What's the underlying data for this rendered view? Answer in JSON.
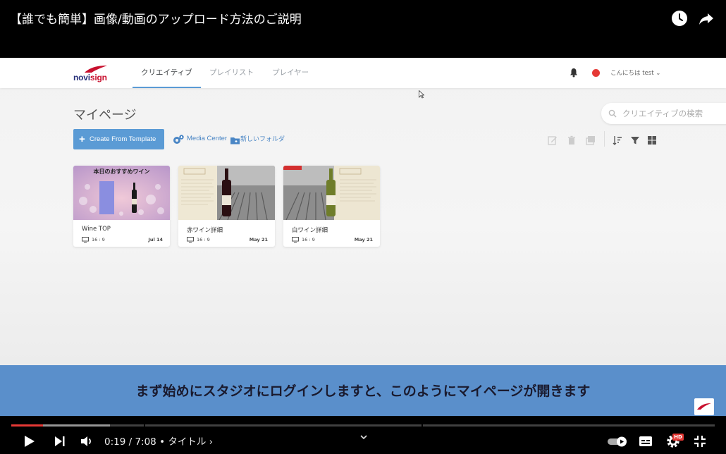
{
  "video": {
    "title": "【誰でも簡単】画像/動画のアップロード方法のご説明",
    "caption": "まず始めにスタジオにログインしますと、このようにマイページが開きます"
  },
  "app": {
    "logo": {
      "part1": "novi",
      "part2": "sign"
    },
    "tabs": [
      {
        "label": "クリエイティブ",
        "active": true
      },
      {
        "label": "プレイリスト",
        "active": false
      },
      {
        "label": "プレイヤー",
        "active": false
      }
    ],
    "greeting": "こんにちは test",
    "page_title": "マイページ",
    "search_placeholder": "クリエイティブの検索",
    "create_button": "Create From Template",
    "media_center": "Media Center",
    "new_folder": "新しいフォルダ",
    "cards": [
      {
        "name": "Wine TOP",
        "ratio": "16 : 9",
        "date": "Jul 14",
        "thumb_title": "本日のおすすめワイン"
      },
      {
        "name": "赤ワイン詳細",
        "ratio": "16 : 9",
        "date": "May 21"
      },
      {
        "name": "白ワイン詳細",
        "ratio": "16 : 9",
        "date": "May 21"
      }
    ]
  },
  "player": {
    "time": "0:19 / 7:08",
    "chapter": "• タイトル ›",
    "progress_fraction": 0.045,
    "buffer_fraction": 0.14,
    "hd_badge": "HD",
    "accent": "#e53935"
  },
  "colors": {
    "accent_blue": "#5b9bd5",
    "caption_band": "#5a8fcb",
    "record_dot": "#e53935"
  }
}
